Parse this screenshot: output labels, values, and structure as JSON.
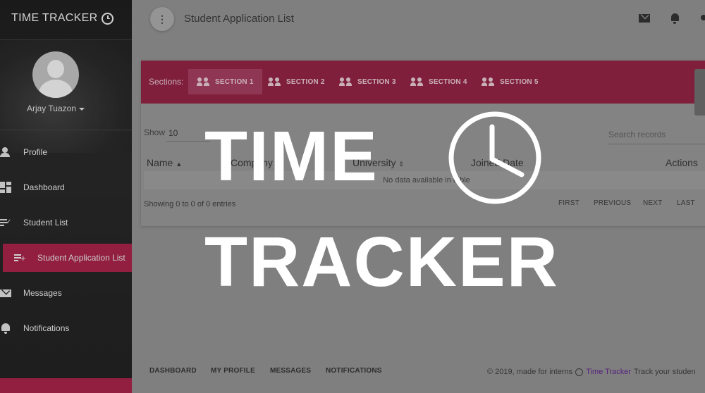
{
  "sidebar": {
    "brand": "TIME TRACKER",
    "username": "Arjay Tuazon",
    "items": [
      {
        "label": "Profile",
        "icon": "person-icon"
      },
      {
        "label": "Dashboard",
        "icon": "dashboard-icon"
      },
      {
        "label": "Student List",
        "icon": "playlist-check-icon"
      },
      {
        "label": "Student Application List",
        "icon": "playlist-add-icon",
        "active": true
      },
      {
        "label": "Messages",
        "icon": "mail-icon"
      },
      {
        "label": "Notifications",
        "icon": "bell-icon"
      }
    ]
  },
  "topbar": {
    "title": "Student Application List",
    "icons": [
      "mail-icon",
      "bell-icon",
      "person-icon"
    ]
  },
  "sections": {
    "label": "Sections:",
    "tabs": [
      "SECTION 1",
      "SECTION 2",
      "SECTION 3",
      "SECTION 4",
      "SECTION 5"
    ]
  },
  "table": {
    "show_label": "Show",
    "show_value": "10",
    "search_placeholder": "Search records",
    "columns": [
      "Name",
      "Company",
      "University",
      "Joined Date",
      "Actions"
    ],
    "empty_message": "No data available in table",
    "entries_info": "Showing 0 to 0 of 0 entries",
    "pager": [
      "FIRST",
      "PREVIOUS",
      "NEXT",
      "LAST"
    ]
  },
  "footer": {
    "links": [
      "DASHBOARD",
      "MY PROFILE",
      "MESSAGES",
      "NOTIFICATIONS"
    ],
    "copyright_prefix": "© 2019, made for interns",
    "brand_link": "Time Tracker",
    "copyright_suffix": "Track your studen"
  },
  "overlay": {
    "line1": "TIME",
    "line2": "TRACKER"
  },
  "colors": {
    "accent": "#a3163f",
    "sidebar_bg": "#141414",
    "overlay_text": "#ffffff"
  }
}
